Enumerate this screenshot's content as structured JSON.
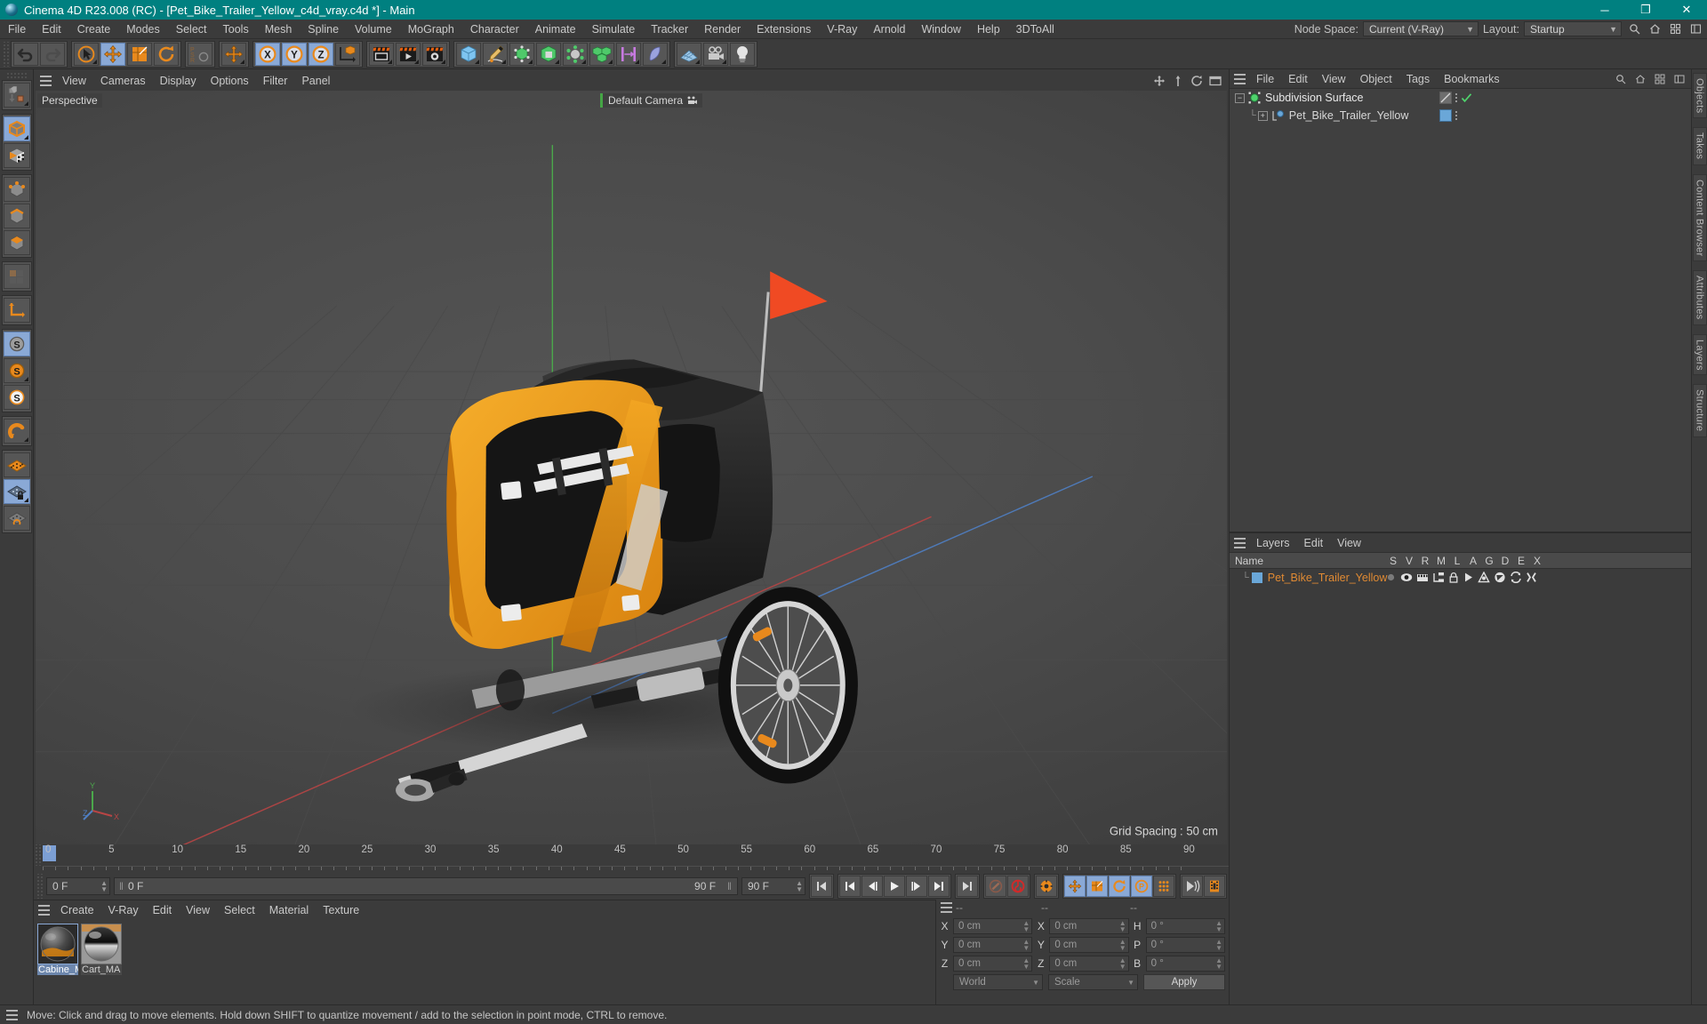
{
  "window": {
    "title": "Cinema 4D R23.008 (RC) - [Pet_Bike_Trailer_Yellow_c4d_vray.c4d *] - Main",
    "minimize": "─",
    "maximize": "❐",
    "close": "✕"
  },
  "menubar": {
    "items": [
      "File",
      "Edit",
      "Create",
      "Modes",
      "Select",
      "Tools",
      "Mesh",
      "Spline",
      "Volume",
      "MoGraph",
      "Character",
      "Animate",
      "Simulate",
      "Tracker",
      "Render",
      "Extensions",
      "V-Ray",
      "Arnold",
      "Window",
      "Help",
      "3DToAll"
    ],
    "node_space_label": "Node Space:",
    "node_space_value": "Current (V-Ray)",
    "layout_label": "Layout:",
    "layout_value": "Startup",
    "search_icon": "search-icon",
    "home_icon": "home-icon",
    "grid_icon": "grid-icon",
    "panel_icon": "panel-icon"
  },
  "viewport": {
    "menu": [
      "View",
      "Cameras",
      "Display",
      "Options",
      "Filter",
      "Panel"
    ],
    "perspective_label": "Perspective",
    "camera_label": "Default Camera",
    "grid_spacing": "Grid Spacing : 50 cm",
    "axis_y": "Y",
    "axis_z": "Z",
    "axis_x": "X"
  },
  "object_manager": {
    "menu": [
      "File",
      "Edit",
      "View",
      "Object",
      "Tags",
      "Bookmarks"
    ],
    "rows": [
      {
        "name": "Subdivision Surface",
        "depth": 0,
        "toggle": "−",
        "dot_color": "#4fd36c"
      },
      {
        "name": "Pet_Bike_Trailer_Yellow",
        "depth": 1,
        "toggle": "+",
        "dot_color": "#6aa7d8"
      }
    ]
  },
  "layers": {
    "menu": [
      "Layers",
      "Edit",
      "View"
    ],
    "name_header": "Name",
    "columns": [
      "S",
      "V",
      "R",
      "M",
      "L",
      "A",
      "G",
      "D",
      "E",
      "X"
    ],
    "rows": [
      {
        "name": "Pet_Bike_Trailer_Yellow",
        "swatch": "#6aa7d8"
      }
    ]
  },
  "right_tabs": [
    "Objects",
    "Takes",
    "Content Browser",
    "Attributes",
    "Layers",
    "Structure"
  ],
  "timeline": {
    "ticks": [
      "0",
      "5",
      "10",
      "15",
      "20",
      "25",
      "30",
      "35",
      "40",
      "45",
      "50",
      "55",
      "60",
      "65",
      "70",
      "75",
      "80",
      "85",
      "90"
    ],
    "current_frame": "0 F",
    "current_frame_2": "0 F",
    "end_frame": "90 F",
    "end_frame_2": "90 F",
    "preview_end": "0 F"
  },
  "material_manager": {
    "menu": [
      "Create",
      "V-Ray",
      "Edit",
      "View",
      "Select",
      "Material",
      "Texture"
    ],
    "materials": [
      {
        "name": "Cabine_M",
        "selected": true
      },
      {
        "name": "Cart_MA",
        "selected": false
      }
    ]
  },
  "coordinates": {
    "header_left": "--",
    "header_mid": "--",
    "header_right": "--",
    "position_label_x": "X",
    "position_label_y": "Y",
    "position_label_z": "Z",
    "size_label_x": "X",
    "size_label_y": "Y",
    "size_label_z": "Z",
    "rot_label_h": "H",
    "rot_label_p": "P",
    "rot_label_b": "B",
    "pos_x": "0 cm",
    "pos_y": "0 cm",
    "pos_z": "0 cm",
    "size_x": "0 cm",
    "size_y": "0 cm",
    "size_z": "0 cm",
    "rot_h": "0 °",
    "rot_p": "0 °",
    "rot_b": "0 °",
    "system": "World",
    "mode": "Scale",
    "apply": "Apply"
  },
  "status": {
    "message": "Move: Click and drag to move elements. Hold down SHIFT to quantize movement / add to the selection in point mode, CTRL to remove."
  },
  "colors": {
    "titlebar": "#008080",
    "accent_orange": "#e8891d",
    "active_blue": "#8aa9d6",
    "layer_orange": "#e08a33",
    "flag_red": "#f04a23",
    "body_yellow": "#eb9b1d"
  }
}
